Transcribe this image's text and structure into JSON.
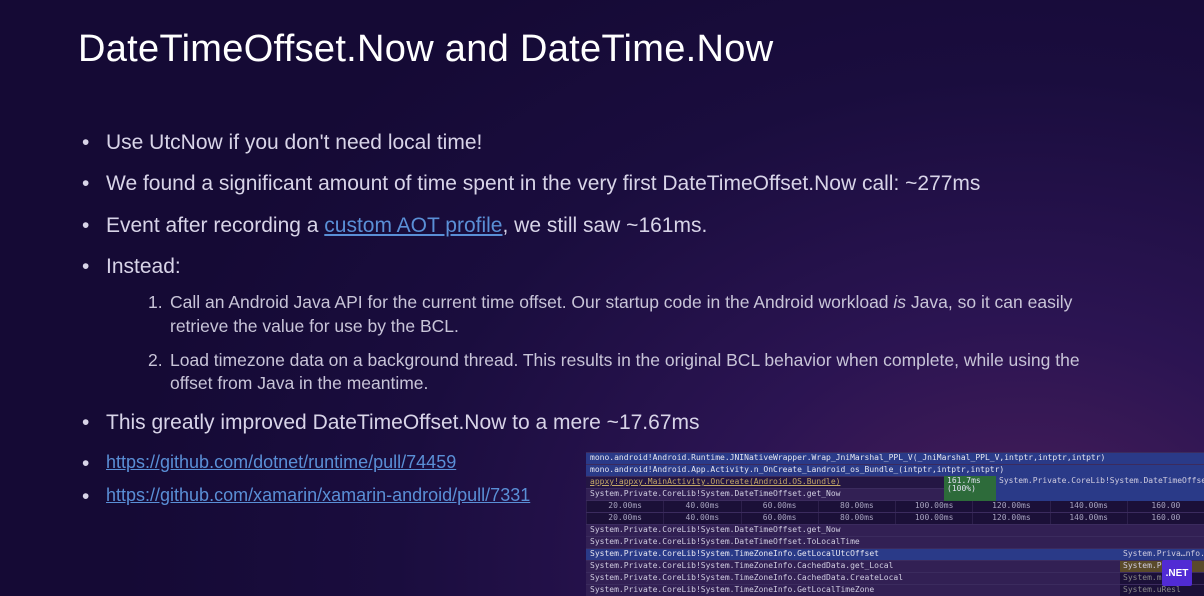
{
  "title": "DateTimeOffset.Now and DateTime.Now",
  "bullets": {
    "b1": "Use UtcNow if you don't need local time!",
    "b2": "We found a significant amount of time spent in the very first DateTimeOffset.Now call: ~277ms",
    "b3_pre": "Event after recording a ",
    "b3_link": "custom AOT profile",
    "b3_post": ", we still saw ~161ms.",
    "b4": "Instead:",
    "sub1_pre": "Call an Android Java API for the current time offset. Our startup code in the Android workload ",
    "sub1_em": "is",
    "sub1_post": " Java, so it can easily retrieve the value for use by the BCL.",
    "sub2": "Load timezone data on a background thread. This results in the original BCL behavior when complete, while using the offset from Java in the meantime.",
    "b5": "This greatly improved DateTimeOffset.Now to a mere ~17.67ms",
    "link1": "https://github.com/dotnet/runtime/pull/74459",
    "link2": "https://github.com/xamarin/xamarin-android/pull/7331"
  },
  "trace": {
    "row1": "mono.android!Android.Runtime.JNINativeWrapper.Wrap_JniMarshal_PPL_V(_JniMarshal_PPL_V,intptr,intptr,intptr)",
    "row2": "mono.android!Android.App.Activity.n_OnCreate_Landroid_os_Bundle_(intptr,intptr,intptr)",
    "row3": "appxy!appxy.MainActivity.OnCreate(Android.OS.Bundle)",
    "row4": "System.Private.CoreLib!System.DateTimeOffset.get_Now",
    "badge_time": "161.7ms (100%)",
    "badge_label": "System.Private.CoreLib!System.DateTimeOffset.get_Now",
    "ticks1": [
      "20.00ms",
      "40.00ms",
      "60.00ms",
      "80.00ms",
      "100.00ms",
      "120.00ms",
      "140.00ms",
      "160.00"
    ],
    "ticks2": [
      "20.00ms",
      "40.00ms",
      "60.00ms",
      "80.00ms",
      "100.00ms",
      "120.00ms",
      "140.00ms",
      "160.00"
    ],
    "row5": "System.Private.CoreLib!System.DateTimeOffset.get_Now",
    "row6": "System.Private.CoreLib!System.DateTimeOffset.ToLocalTime",
    "row7": "System.Private.CoreLib!System.TimeZoneInfo.GetLocalUtcOffset",
    "row8": "System.Private.CoreLib!System.TimeZoneInfo.CachedData.get_Local",
    "row9": "System.Private.CoreLib!System.TimeZoneInfo.CachedData.CreateLocal",
    "row10": "System.Private.CoreLib!System.TimeZoneInfo.GetLocalTimeZone",
    "rc7": "System.Priva…nfo..cctor",
    "rc8": "System.Priv…",
    "rc9": "System.meZon",
    "rc10": "System.uResl"
  },
  "dotnet": ".NET"
}
